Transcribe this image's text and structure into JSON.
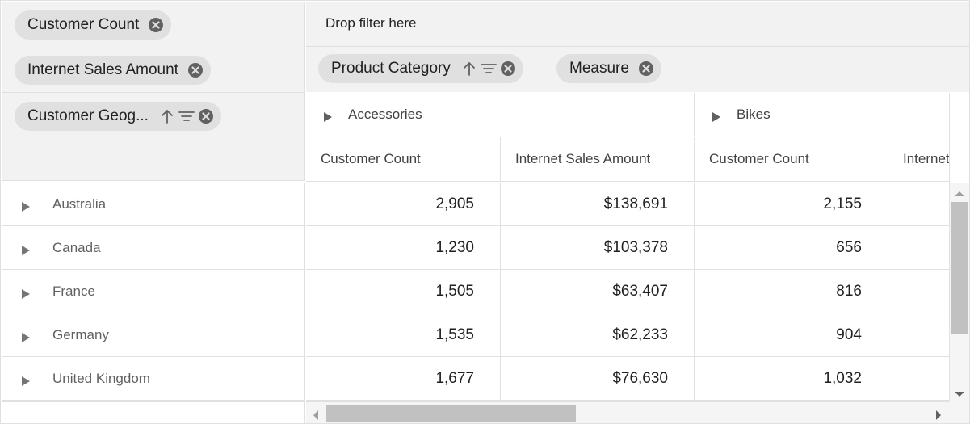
{
  "values_axis": {
    "pills": [
      {
        "label": "Customer Count",
        "remove_icon": "close-circle-icon"
      },
      {
        "label": "Internet Sales Amount",
        "remove_icon": "close-circle-icon"
      }
    ]
  },
  "filter_axis": {
    "drop_text": "Drop filter here"
  },
  "column_axis": {
    "pills": [
      {
        "label": "Product Category",
        "sort_icon": "arrow-up-icon",
        "filter_icon": "filter-icon",
        "remove_icon": "close-circle-icon"
      },
      {
        "label": "Measure",
        "remove_icon": "close-circle-icon"
      }
    ]
  },
  "row_axis": {
    "pills": [
      {
        "label": "Customer Geog...",
        "sort_icon": "arrow-up-icon",
        "filter_icon": "filter-icon",
        "remove_icon": "close-circle-icon"
      }
    ]
  },
  "column_headers": {
    "categories": [
      {
        "label": "Accessories",
        "icon": "expand-triangle-icon"
      },
      {
        "label": "Bikes",
        "icon": "expand-triangle-icon"
      }
    ],
    "measures": [
      "Customer Count",
      "Internet Sales Amount",
      "Customer Count",
      "Internet Sales Amount"
    ]
  },
  "rows": [
    {
      "label": "Australia",
      "values": [
        "2,905",
        "$138,691",
        "2,155",
        ""
      ]
    },
    {
      "label": "Canada",
      "values": [
        "1,230",
        "$103,378",
        "656",
        ""
      ]
    },
    {
      "label": "France",
      "values": [
        "1,505",
        "$63,407",
        "816",
        ""
      ]
    },
    {
      "label": "Germany",
      "values": [
        "1,535",
        "$62,233",
        "904",
        ""
      ]
    },
    {
      "label": "United Kingdom",
      "values": [
        "1,677",
        "$76,630",
        "1,032",
        ""
      ]
    }
  ],
  "colors": {
    "grouping_bar_bg": "#f2f2f2",
    "pill_bg": "#e0e0e0",
    "icon_color": "#616161",
    "border": "#e0e0e0",
    "scroll_thumb": "#c1c1c1"
  }
}
